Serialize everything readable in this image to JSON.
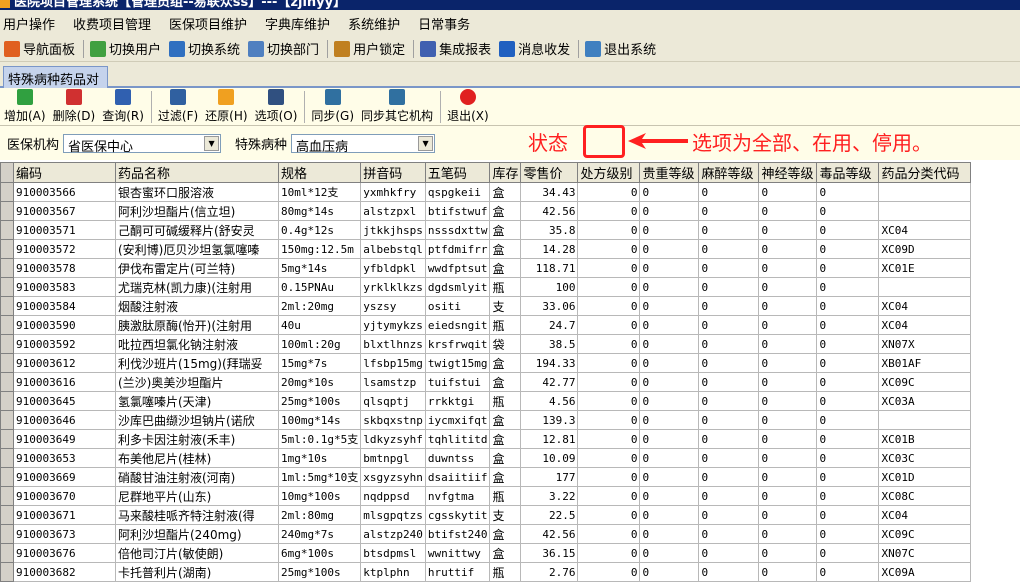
{
  "window": {
    "title": "医院项目管理系统【管理员组--易联众ss】---【zjlnyy】"
  },
  "menu": [
    "用户操作",
    "收费项目管理",
    "医保项目维护",
    "字典库维护",
    "系统维护",
    "日常事务"
  ],
  "toolbar": [
    {
      "label": "导航面板",
      "icon": "navigation-panel-icon",
      "color": "#e06020"
    },
    {
      "label": "切换用户",
      "icon": "switch-user-icon",
      "color": "#40a040"
    },
    {
      "label": "切换系统",
      "icon": "switch-system-icon",
      "color": "#3070c0"
    },
    {
      "label": "切换部门",
      "icon": "switch-department-icon",
      "color": "#5080c0"
    },
    {
      "label": "用户锁定",
      "icon": "user-lock-icon",
      "color": "#c08020"
    },
    {
      "label": "集成报表",
      "icon": "report-icon",
      "color": "#4060b0"
    },
    {
      "label": "消息收发",
      "icon": "message-icon",
      "color": "#2060c0"
    },
    {
      "label": "退出系统",
      "icon": "exit-system-icon",
      "color": "#4080c0"
    }
  ],
  "tab": "特殊病种药品对应",
  "actions": [
    {
      "label": "增加(A)",
      "icon": "add-icon",
      "color": "#30a040"
    },
    {
      "label": "删除(D)",
      "icon": "delete-icon",
      "color": "#d03030"
    },
    {
      "label": "查询(R)",
      "icon": "refresh-icon",
      "color": "#3060b0"
    },
    {
      "label": "过滤(F)",
      "icon": "filter-icon",
      "color": "#3060a0"
    },
    {
      "label": "还原(H)",
      "icon": "restore-icon",
      "color": "#f0a020"
    },
    {
      "label": "选项(O)",
      "icon": "options-icon",
      "color": "#305080"
    },
    {
      "label": "同步(G)",
      "icon": "sync-icon",
      "color": "#3070a0"
    },
    {
      "label": "同步其它机构",
      "icon": "sync-other-icon",
      "color": "#3070a0"
    },
    {
      "label": "退出(X)",
      "icon": "power-icon",
      "color": "#e02020"
    }
  ],
  "filter": {
    "org_label": "医保机构",
    "org_value": "省医保中心",
    "disease_label": "特殊病种",
    "disease_value": "高血压病"
  },
  "annotation": {
    "status": "状态",
    "note": "选项为全部、在用、停用。",
    "color": "#ff2020"
  },
  "columns": [
    "编码",
    "药品名称",
    "规格",
    "拼音码",
    "五笔码",
    "库存",
    "零售价",
    "处方级别",
    "贵重等级",
    "麻醉等级",
    "神经等级",
    "毒品等级",
    "药品分类代码"
  ],
  "rows": [
    [
      "910003566",
      "银杏蜜环口服溶液",
      "10ml*12支",
      "yxmhkfry",
      "qspgkeii",
      "盒",
      "34.43",
      "0",
      "0",
      "0",
      "0",
      "0",
      ""
    ],
    [
      "910003567",
      "阿利沙坦酯片(信立坦)",
      "80mg*14s",
      "alstzpxl",
      "btifstwuf",
      "盒",
      "42.56",
      "0",
      "0",
      "0",
      "0",
      "0",
      ""
    ],
    [
      "910003571",
      "己酮可可碱缓释片(舒安灵",
      "0.4g*12s",
      "jtkkjhsps",
      "nsssdxttw",
      "盒",
      "35.8",
      "0",
      "0",
      "0",
      "0",
      "0",
      "XC04"
    ],
    [
      "910003572",
      "(安利博)厄贝沙坦氢氯噻嗪",
      "150mg:12.5m",
      "albebstql",
      "ptfdmifrr",
      "盒",
      "14.28",
      "0",
      "0",
      "0",
      "0",
      "0",
      "XC09D"
    ],
    [
      "910003578",
      "伊伐布雷定片(可兰特)",
      "5mg*14s",
      "yfbldpkl",
      "wwdfptsut",
      "盒",
      "118.71",
      "0",
      "0",
      "0",
      "0",
      "0",
      "XC01E"
    ],
    [
      "910003583",
      "尤瑞克林(凯力康)(注射用",
      "0.15PNAu",
      "yrklklkzs",
      "dgdsmlyit",
      "瓶",
      "100",
      "0",
      "0",
      "0",
      "0",
      "0",
      ""
    ],
    [
      "910003584",
      "烟酸注射液",
      "2ml:20mg",
      "yszsy",
      "ositi",
      "支",
      "33.06",
      "0",
      "0",
      "0",
      "0",
      "0",
      "XC04"
    ],
    [
      "910003590",
      "胰激肽原酶(怡开)(注射用",
      "40u",
      "yjtymykzs",
      "eiedsngit",
      "瓶",
      "24.7",
      "0",
      "0",
      "0",
      "0",
      "0",
      "XC04"
    ],
    [
      "910003592",
      "吡拉西坦氯化钠注射液",
      "100ml:20g",
      "blxtlhnzs",
      "krsfrwqit",
      "袋",
      "38.5",
      "0",
      "0",
      "0",
      "0",
      "0",
      "XN07X"
    ],
    [
      "910003612",
      "利伐沙班片(15mg)(拜瑞妥",
      "15mg*7s",
      "lfsbp15mg",
      "twigt15mg",
      "盒",
      "194.33",
      "0",
      "0",
      "0",
      "0",
      "0",
      "XB01AF"
    ],
    [
      "910003616",
      "(兰沙)奥美沙坦酯片",
      "20mg*10s",
      "lsamstzp",
      "tuifstui",
      "盒",
      "42.77",
      "0",
      "0",
      "0",
      "0",
      "0",
      "XC09C"
    ],
    [
      "910003645",
      "氢氯噻嗪片(天津)",
      "25mg*100s",
      "qlsqptj",
      "rrkktgi",
      "瓶",
      "4.56",
      "0",
      "0",
      "0",
      "0",
      "0",
      "XC03A"
    ],
    [
      "910003646",
      "沙库巴曲缬沙坦钠片(诺欣",
      "100mg*14s",
      "skbqxstnp",
      "iycmxifqt",
      "盒",
      "139.3",
      "0",
      "0",
      "0",
      "0",
      "0",
      ""
    ],
    [
      "910003649",
      "利多卡因注射液(禾丰)",
      "5ml:0.1g*5支",
      "ldkyzsyhf",
      "tqhlititd",
      "盒",
      "12.81",
      "0",
      "0",
      "0",
      "0",
      "0",
      "XC01B"
    ],
    [
      "910003653",
      "布美他尼片(桂林)",
      "1mg*10s",
      "bmtnpgl",
      "duwntss",
      "盒",
      "10.09",
      "0",
      "0",
      "0",
      "0",
      "0",
      "XC03C"
    ],
    [
      "910003669",
      "硝酸甘油注射液(河南)",
      "1ml:5mg*10支",
      "xsgyzsyhn",
      "dsaiitiif",
      "盒",
      "177",
      "0",
      "0",
      "0",
      "0",
      "0",
      "XC01D"
    ],
    [
      "910003670",
      "尼群地平片(山东)",
      "10mg*100s",
      "nqdppsd",
      "nvfgtma",
      "瓶",
      "3.22",
      "0",
      "0",
      "0",
      "0",
      "0",
      "XC08C"
    ],
    [
      "910003671",
      "马来酸桂哌齐特注射液(得",
      "2ml:80mg",
      "mlsgpqtzs",
      "cgsskytit",
      "支",
      "22.5",
      "0",
      "0",
      "0",
      "0",
      "0",
      "XC04"
    ],
    [
      "910003673",
      "阿利沙坦酯片(240mg)",
      "240mg*7s",
      "alstzp240",
      "btifst240",
      "盒",
      "42.56",
      "0",
      "0",
      "0",
      "0",
      "0",
      "XC09C"
    ],
    [
      "910003676",
      "倍他司汀片(敏使朗)",
      "6mg*100s",
      "btsdpmsl",
      "wwnittwy",
      "盒",
      "36.15",
      "0",
      "0",
      "0",
      "0",
      "0",
      "XN07C"
    ],
    [
      "910003682",
      "卡托普利片(湖南)",
      "25mg*100s",
      "ktplphn",
      "hruttif",
      "瓶",
      "2.76",
      "0",
      "0",
      "0",
      "0",
      "0",
      "XC09A"
    ]
  ]
}
